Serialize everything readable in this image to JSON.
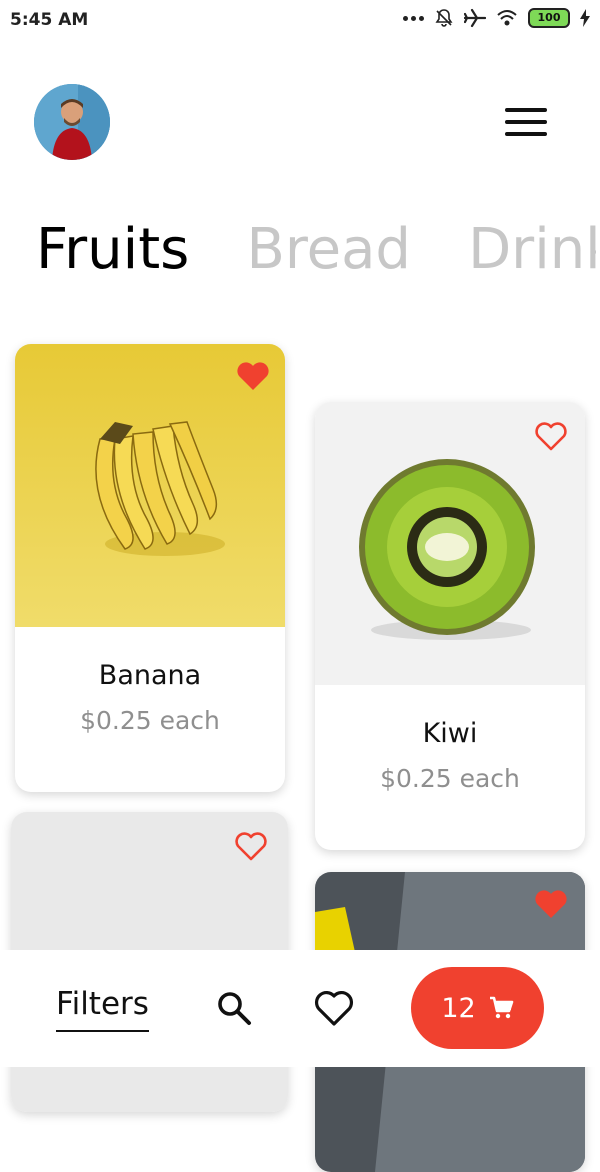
{
  "status": {
    "time": "5:45 AM",
    "battery": "100",
    "icons": [
      "more-dots-icon",
      "bell-off-icon",
      "airplane-icon",
      "wifi-icon",
      "battery-icon",
      "charging-icon"
    ]
  },
  "header": {
    "avatar_icon": "user-avatar",
    "menu_icon": "hamburger-menu-icon"
  },
  "tabs": [
    {
      "label": "Fruits",
      "active": true
    },
    {
      "label": "Bread",
      "active": false
    },
    {
      "label": "Drinks",
      "active": false
    }
  ],
  "products": [
    {
      "name": "Banana",
      "price": "$0.25 each",
      "favorited": true
    },
    {
      "name": "Kiwi",
      "price": "$0.25 each",
      "favorited": false
    },
    {
      "name": "",
      "price": "",
      "favorited": false
    },
    {
      "name": "",
      "price": "",
      "favorited": true
    }
  ],
  "bottom_bar": {
    "filters_label": "Filters",
    "cart_count": "12",
    "icons": [
      "search-icon",
      "heart-outline-icon",
      "cart-icon"
    ]
  },
  "colors": {
    "accent": "#f0412f",
    "inactive_tab": "#c7c7c7",
    "price": "#8f8f8f"
  }
}
